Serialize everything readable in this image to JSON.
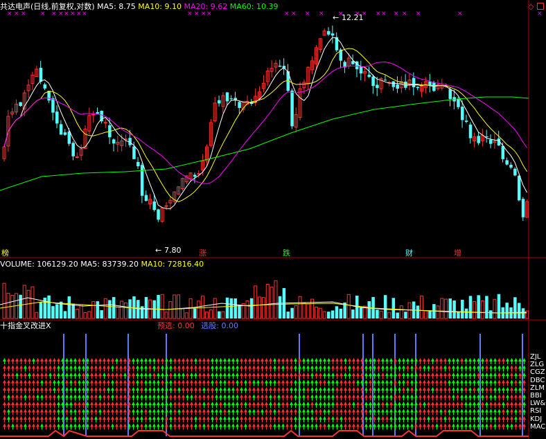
{
  "colors": {
    "red": "#ff3232",
    "cyan": "#54fcfc",
    "white": "#ffffff",
    "yellow": "#ffff00",
    "magenta": "#ff00ff",
    "green": "#00ff00",
    "blue": "#5f7bff",
    "orange": "#ff8c00"
  },
  "main_header": {
    "title": "共达电声(日线,前复权,对数)",
    "ma5": "MA5: 8.75",
    "ma10": "MA10: 9.10",
    "ma20": "MA20: 9.62",
    "ma60": "MA60: 10.39"
  },
  "price_labels": {
    "high": "12.21",
    "low": "7.80"
  },
  "event_tags": [
    {
      "text": "榜",
      "color": "#ffff00"
    },
    {
      "text": "涨",
      "color": "#ff3232"
    },
    {
      "text": "跌",
      "color": "#00ff00"
    },
    {
      "text": "财",
      "color": "#54fcfc"
    },
    {
      "text": "增",
      "color": "#ff3232"
    }
  ],
  "volume_header": {
    "volume": "VOLUME: 106129.20",
    "ma5": "MA5: 83739.20",
    "ma10": "MA10: 72816.40"
  },
  "indicator_header": {
    "title": "十指金叉改进X",
    "preselect": "预选: 0.00",
    "select": "选股: 0.00"
  },
  "indicator_rows": [
    "ZJL",
    "ZLG",
    "CGZ",
    "DBC",
    "ZLM",
    "BBI",
    "LW&",
    "RSI",
    "KDJ",
    "MAC"
  ],
  "chart_data": {
    "type": "candlestick",
    "title": "共达电声(日线,前复权,对数)",
    "price_high_label": 12.21,
    "price_low_label": 7.8,
    "ylim": [
      7.5,
      12.5
    ],
    "series": [
      {
        "name": "MA5",
        "last": 8.75
      },
      {
        "name": "MA10",
        "last": 9.1
      },
      {
        "name": "MA20",
        "last": 9.62
      },
      {
        "name": "MA60",
        "last": 10.39
      }
    ],
    "volume": {
      "last": 106129.2,
      "ma5": 83739.2,
      "ma10": 72816.4
    }
  }
}
